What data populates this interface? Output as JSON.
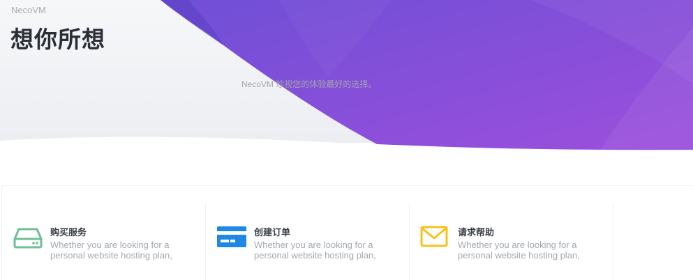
{
  "header": {
    "brand": "NecoVM",
    "title": "想你所想",
    "tagline": "NecoVM 珍视您的体验最好的选择。"
  },
  "colors": {
    "hero_purple_start": "#6f4fd6",
    "hero_purple_end": "#9c4fdc",
    "icon_server": "#6fbf97",
    "icon_card": "#1e88e5",
    "icon_mail": "#f7c21a"
  },
  "cards": [
    {
      "icon": "server-icon",
      "title": "购买服务",
      "desc_line1": "Whether you are looking for a",
      "desc_line2": "personal website hosting plan,"
    },
    {
      "icon": "credit-card-icon",
      "title": "创建订单",
      "desc_line1": "Whether you are looking for a",
      "desc_line2": "personal website hosting plan,"
    },
    {
      "icon": "mail-icon",
      "title": "请求帮助",
      "desc_line1": "Whether you are looking for a",
      "desc_line2": "personal website hosting plan,"
    }
  ]
}
